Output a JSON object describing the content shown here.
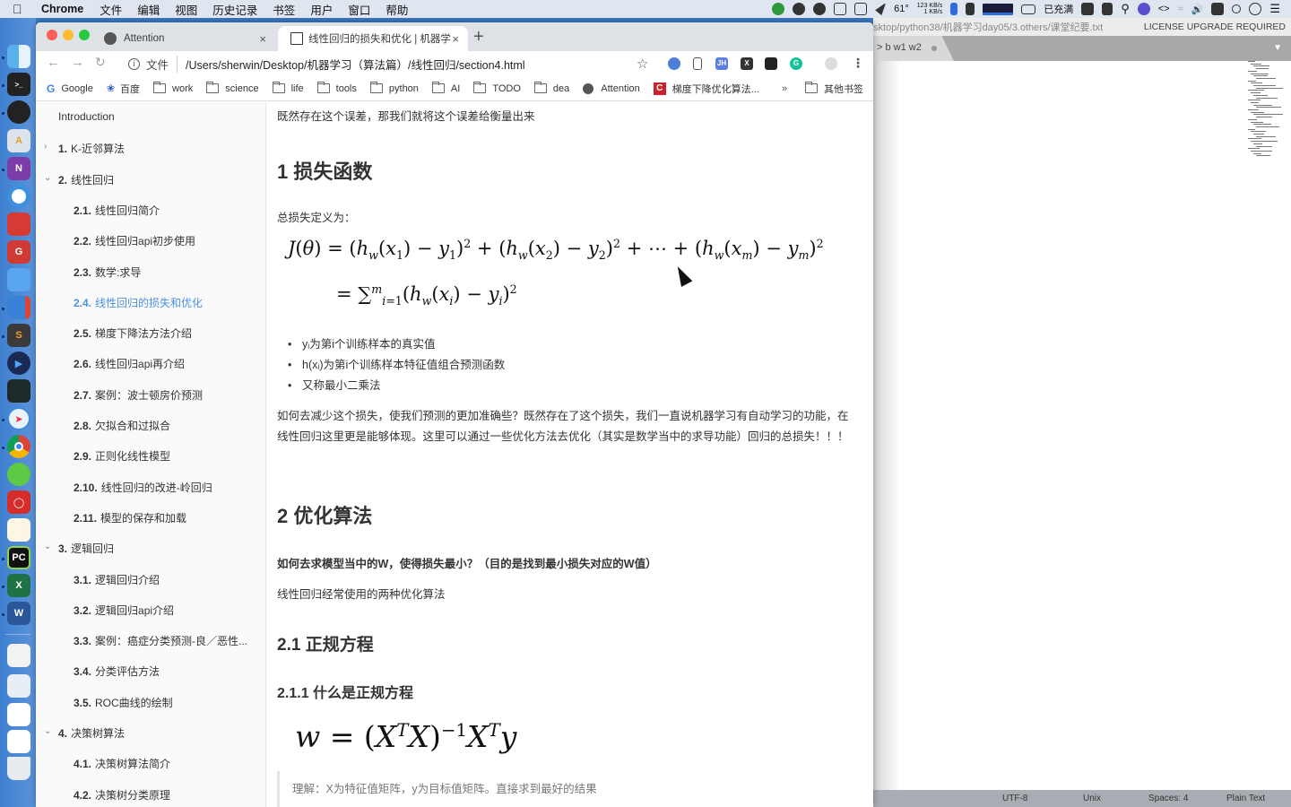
{
  "menubar": {
    "apple_icon": "apple-icon",
    "app_name": "Chrome",
    "items": [
      "文件",
      "编辑",
      "视图",
      "历史记录",
      "书签",
      "用户",
      "窗口",
      "帮助"
    ],
    "status": {
      "temperature": "61°",
      "net_up": "123 KB/s",
      "net_down": "1 KB/s",
      "battery_label": "已充满"
    }
  },
  "browser": {
    "tabs": [
      {
        "title": "Attention",
        "icon": "globe-icon",
        "active": false
      },
      {
        "title": "线性回归的损失和优化 | 机器学",
        "icon": "book-icon",
        "active": true
      }
    ],
    "new_tab": "+",
    "tab_close": "×",
    "address": {
      "scheme_label": "文件",
      "url": "/Users/sherwin/Desktop/机器学习（算法篇）/线性回归/section4.html",
      "info_icon": "i"
    },
    "extensions": [
      {
        "name": "translate-ext-icon",
        "label": "",
        "color": "#4d7fd8"
      },
      {
        "name": "bookmark-ext-icon",
        "label": "",
        "color": "#ffffff"
      },
      {
        "name": "jh-ext-icon",
        "label": "JH",
        "color": "#5b7fe0"
      },
      {
        "name": "x-ext-icon",
        "label": "X",
        "color": "#333333"
      },
      {
        "name": "tampermonkey-ext-icon",
        "label": "",
        "color": "#222222"
      },
      {
        "name": "grammarly-ext-icon",
        "label": "G",
        "color": "#15c39a"
      }
    ],
    "bookmarks": [
      {
        "label": "Google",
        "icon": "google"
      },
      {
        "label": "百度",
        "icon": "baidu"
      },
      {
        "label": "work",
        "icon": "folder"
      },
      {
        "label": "science",
        "icon": "folder"
      },
      {
        "label": "life",
        "icon": "folder"
      },
      {
        "label": "tools",
        "icon": "folder"
      },
      {
        "label": "python",
        "icon": "folder"
      },
      {
        "label": "AI",
        "icon": "folder"
      },
      {
        "label": "TODO",
        "icon": "folder"
      },
      {
        "label": "dea",
        "icon": "folder"
      },
      {
        "label": "Attention",
        "icon": "globe"
      },
      {
        "label": "梯度下降优化算法...",
        "icon": "csdn"
      }
    ],
    "bookmarks_more": "»",
    "other_bookmarks": "其他书签"
  },
  "sidebar": {
    "items": [
      {
        "num": "",
        "label": "Introduction",
        "level": 0,
        "chevron": ""
      },
      {
        "num": "1.",
        "label": "K-近邻算法",
        "level": 0,
        "chevron": "›"
      },
      {
        "num": "2.",
        "label": "线性回归",
        "level": 0,
        "chevron": "⌄"
      },
      {
        "num": "2.1.",
        "label": "线性回归简介",
        "level": 1
      },
      {
        "num": "2.2.",
        "label": "线性回归api初步使用",
        "level": 1
      },
      {
        "num": "2.3.",
        "label": "数学:求导",
        "level": 1
      },
      {
        "num": "2.4.",
        "label": "线性回归的损失和优化",
        "level": 1,
        "active": true
      },
      {
        "num": "2.5.",
        "label": "梯度下降法方法介绍",
        "level": 1
      },
      {
        "num": "2.6.",
        "label": "线性回归api再介绍",
        "level": 1
      },
      {
        "num": "2.7.",
        "label": "案例：波士顿房价预测",
        "level": 1
      },
      {
        "num": "2.8.",
        "label": "欠拟合和过拟合",
        "level": 1
      },
      {
        "num": "2.9.",
        "label": "正则化线性模型",
        "level": 1
      },
      {
        "num": "2.10.",
        "label": "线性回归的改进-岭回归",
        "level": 1
      },
      {
        "num": "2.11.",
        "label": "模型的保存和加载",
        "level": 1
      },
      {
        "num": "3.",
        "label": "逻辑回归",
        "level": 0,
        "chevron": "⌄"
      },
      {
        "num": "3.1.",
        "label": "逻辑回归介绍",
        "level": 1
      },
      {
        "num": "3.2.",
        "label": "逻辑回归api介绍",
        "level": 1
      },
      {
        "num": "3.3.",
        "label": "案例：癌症分类预测-良／恶性...",
        "level": 1
      },
      {
        "num": "3.4.",
        "label": "分类评估方法",
        "level": 1
      },
      {
        "num": "3.5.",
        "label": "ROC曲线的绘制",
        "level": 1
      },
      {
        "num": "4.",
        "label": "决策树算法",
        "level": 0,
        "chevron": "⌄"
      },
      {
        "num": "4.1.",
        "label": "决策树算法简介",
        "level": 1
      },
      {
        "num": "4.2.",
        "label": "决策树分类原理",
        "level": 1
      }
    ]
  },
  "content": {
    "intro": "既然存在这个误差，那我们就将这个误差给衡量出来",
    "h1_loss": "1 损失函数",
    "loss_def": "总损失定义为：",
    "formula_loss_line1": "J(θ) = (h_w(x_1) − y_1)^2 + (h_w(x_2) − y_2)^2 + ⋯ + (h_w(x_m) − y_m)^2",
    "formula_loss_line2": "= Σ_{i=1}^{m} (h_w(x_i) − y_i)^2",
    "bullets": [
      "yᵢ为第i个训练样本的真实值",
      "h(xᵢ)为第i个训练样本特征值组合预测函数",
      "又称最小二乘法"
    ],
    "para": "如何去减少这个损失，使我们预测的更加准确些？既然存在了这个损失，我们一直说机器学习有自动学习的功能，在线性回归这里更是能够体现。这里可以通过一些优化方法去优化（其实是数学当中的求导功能）回归的总损失！！！",
    "h1_opt": "2 优化算法",
    "bold_question": "如何去求模型当中的W，使得损失最小？（目的是找到最小损失对应的W值）",
    "two_methods": "线性回归经常使用的两种优化算法",
    "h2_normal": "2.1 正规方程",
    "h3_what": "2.1.1 什么是正规方程",
    "formula_normal": "w = (X^T X)^{-1} X^T y",
    "quote": "理解：X为特征值矩阵，y为目标值矩阵。直接求到最好的结果"
  },
  "sublime": {
    "title_path": "sktop/python38/机器学习day05/3.others/课堂纪要.txt",
    "license": "LICENSE UPGRADE REQUIRED",
    "tab_label": "> b w1 w2",
    "status": {
      "encoding": "UTF-8",
      "line_endings": "Unix",
      "indent": "Spaces: 4",
      "syntax": "Plain Text"
    }
  }
}
